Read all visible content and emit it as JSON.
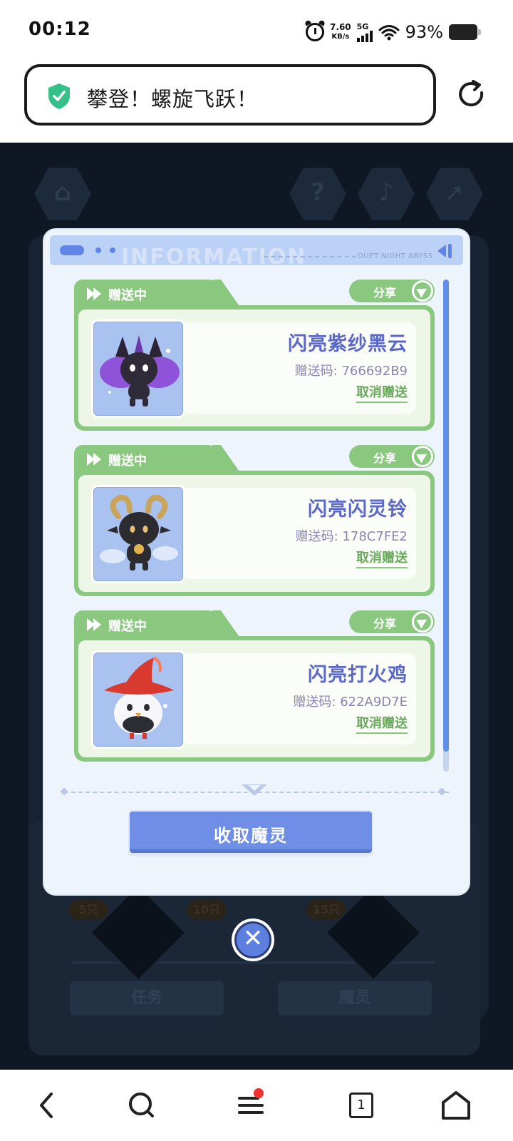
{
  "status_bar": {
    "time": "00:12",
    "net_speed_value": "7.60",
    "net_speed_unit": "KB/s",
    "network_type": "5G",
    "battery_percent": "93%"
  },
  "browser": {
    "page_title": "攀登！螺旋飞跃！",
    "shield_color": "#35c08a"
  },
  "game_background": {
    "tab_tasks": "任务",
    "tab_spirits": "魔灵",
    "badges": [
      "5只",
      "10只",
      "15只"
    ]
  },
  "modal": {
    "header_brand": "DUET NIGHT ABYSS",
    "header_deco_text": "INFORMATION",
    "gifts": [
      {
        "status": "赠送中",
        "share_label": "分享",
        "name": "闪亮紫纱黑云",
        "code_label": "赠送码:",
        "code": "766692B9",
        "cancel_label": "取消赠送",
        "image": "shiny-purple-black-cloud-creature"
      },
      {
        "status": "赠送中",
        "share_label": "分享",
        "name": "闪亮闪灵铃",
        "code_label": "赠送码:",
        "code": "178C7FE2",
        "cancel_label": "取消赠送",
        "image": "shiny-horned-bell-creature"
      },
      {
        "status": "赠送中",
        "share_label": "分享",
        "name": "闪亮打火鸡",
        "code_label": "赠送码:",
        "code": "622A9D7E",
        "cancel_label": "取消赠送",
        "image": "shiny-red-hat-chick-creature"
      }
    ],
    "collect_button_label": "收取魔灵",
    "close_label": "✕"
  },
  "nav_bar": {
    "tabs_count": "1"
  },
  "colors": {
    "accent_green": "#8ac880",
    "accent_blue": "#5f85e6",
    "name_text": "#5b68c6"
  }
}
